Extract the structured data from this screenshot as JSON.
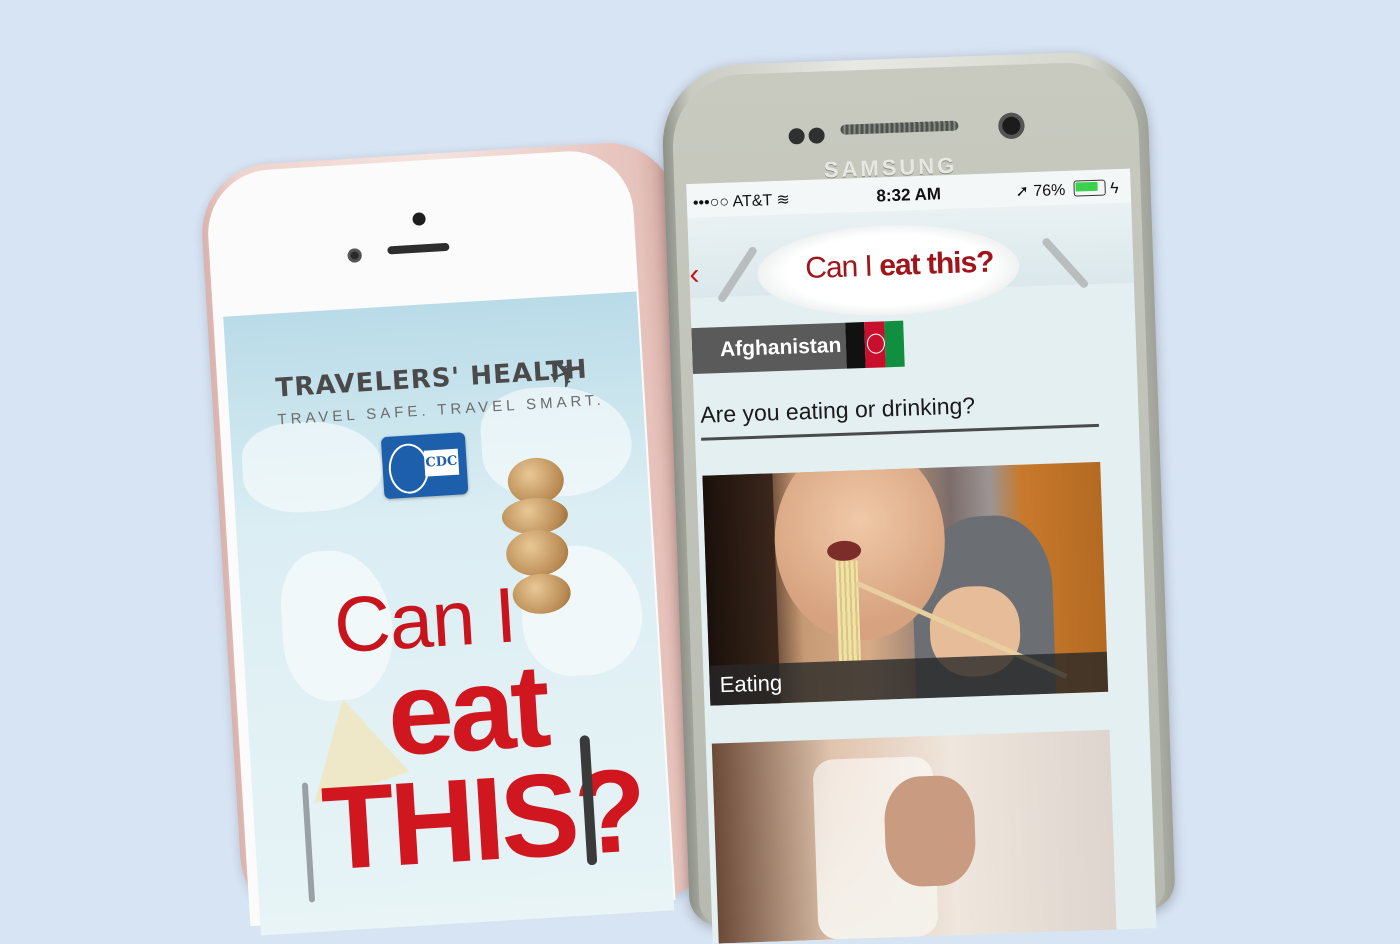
{
  "iphone_app": {
    "brand_title": "TRAVELERS' HEALTH",
    "tagline": "TRAVEL SAFE. TRAVEL SMART.",
    "agency_logo": "CDC",
    "hero_line1": "Can I",
    "hero_line2": "eat",
    "hero_line3": "THIS?",
    "plane_icon": "airplane-icon"
  },
  "samsung_device": {
    "brand": "SAMSUNG"
  },
  "app_screen": {
    "status_bar": {
      "carrier": "•••○○ AT&T",
      "time": "8:32 AM",
      "battery": "76%"
    },
    "header": {
      "title_plain": "Can I ",
      "title_bold": "eat this?"
    },
    "country": {
      "name": "Afghanistan",
      "flag_colors": [
        "#111111",
        "#c8102e",
        "#0f8f3f"
      ]
    },
    "question": "Are you eating or drinking?",
    "options": [
      {
        "label": "Eating"
      },
      {
        "label": ""
      }
    ]
  },
  "colors": {
    "background": "#d7e4f4",
    "brand_red": "#d0161e",
    "header_red": "#a0141b"
  }
}
